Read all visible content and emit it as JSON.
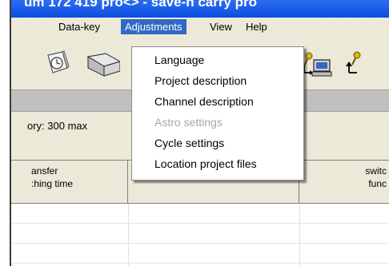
{
  "window": {
    "title": "um 172 419 pro<> - save-n carry pro"
  },
  "menubar": {
    "items": [
      {
        "label": "Data-key",
        "active": false
      },
      {
        "label": "Adjustments",
        "active": true
      },
      {
        "label": "View",
        "active": false
      },
      {
        "label": "Help",
        "active": false
      }
    ]
  },
  "dropdown": {
    "items": [
      {
        "label": "Language",
        "enabled": true
      },
      {
        "label": "Project description",
        "enabled": true
      },
      {
        "label": "Channel description",
        "enabled": true
      },
      {
        "label": "Astro settings",
        "enabled": false
      },
      {
        "label": "Cycle settings",
        "enabled": true
      },
      {
        "label": "Location project files",
        "enabled": true
      }
    ]
  },
  "status": {
    "memory_text": "ory: 300  max"
  },
  "table": {
    "columns": [
      {
        "line1": "ansfer",
        "line2": ":hing time"
      },
      {
        "line1": "",
        "line2": ""
      },
      {
        "line1": "switc",
        "line2": "func"
      }
    ]
  },
  "toolbar": {
    "icons": [
      "clock-document-icon",
      "envelope-icon",
      "computer-transfer-icon",
      "key-transfer-icon"
    ]
  },
  "colors": {
    "menu_highlight": "#316ac5",
    "disabled_text": "#a7a6aa",
    "window_bg": "#ece9d8"
  }
}
